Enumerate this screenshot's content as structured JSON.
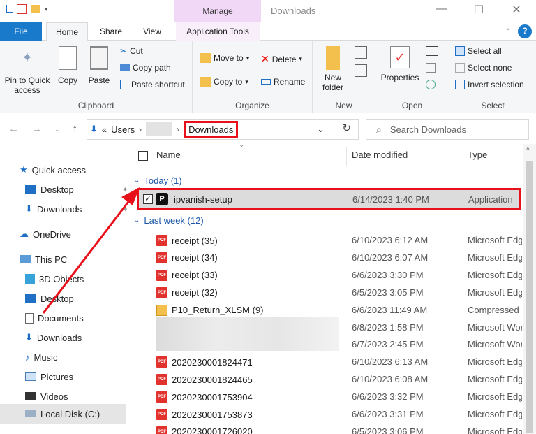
{
  "window": {
    "context_tab": "Manage",
    "title": "Downloads",
    "minimize_glyph": "—",
    "maximize_glyph": "☐",
    "close_glyph": "✕"
  },
  "tabs": {
    "file": "File",
    "home": "Home",
    "share": "Share",
    "view": "View",
    "app_tools": "Application Tools"
  },
  "ribbon": {
    "clipboard": {
      "label": "Clipboard",
      "pin": "Pin to Quick access",
      "copy": "Copy",
      "paste": "Paste",
      "cut": "Cut",
      "copy_path": "Copy path",
      "paste_shortcut": "Paste shortcut"
    },
    "organize": {
      "label": "Organize",
      "move_to": "Move to",
      "copy_to": "Copy to",
      "delete": "Delete",
      "rename": "Rename"
    },
    "new": {
      "label": "New",
      "new_folder": "New folder"
    },
    "open": {
      "label": "Open",
      "properties": "Properties"
    },
    "select": {
      "label": "Select",
      "select_all": "Select all",
      "select_none": "Select none",
      "invert": "Invert selection"
    }
  },
  "address": {
    "prefix": "«",
    "users": "Users",
    "downloads": "Downloads",
    "search_placeholder": "Search Downloads"
  },
  "nav": {
    "quick_access": "Quick access",
    "desktop": "Desktop",
    "downloads": "Downloads",
    "onedrive": "OneDrive",
    "this_pc": "This PC",
    "objects3d": "3D Objects",
    "desktop2": "Desktop",
    "documents": "Documents",
    "downloads2": "Downloads",
    "music": "Music",
    "pictures": "Pictures",
    "videos": "Videos",
    "local_disk": "Local Disk (C:)"
  },
  "columns": {
    "name": "Name",
    "date": "Date modified",
    "type": "Type"
  },
  "groups": {
    "today": "Today (1)",
    "last_week": "Last week (12)"
  },
  "selected_file": {
    "name": "ipvanish-setup",
    "date": "6/14/2023 1:40 PM",
    "type": "Application"
  },
  "files": [
    {
      "name": "receipt (35)",
      "date": "6/10/2023 6:12 AM",
      "type": "Microsoft Edge",
      "icon": "pdf"
    },
    {
      "name": "receipt (34)",
      "date": "6/10/2023 6:07 AM",
      "type": "Microsoft Edge",
      "icon": "pdf"
    },
    {
      "name": "receipt (33)",
      "date": "6/6/2023 3:30 PM",
      "type": "Microsoft Edge",
      "icon": "pdf"
    },
    {
      "name": "receipt (32)",
      "date": "6/5/2023 3:05 PM",
      "type": "Microsoft Edge",
      "icon": "pdf"
    },
    {
      "name": "P10_Return_XLSM (9)",
      "date": "6/6/2023 11:49 AM",
      "type": "Compressed",
      "icon": "zip"
    },
    {
      "name": "",
      "date": "6/8/2023 1:58 PM",
      "type": "Microsoft Word",
      "icon": "blur"
    },
    {
      "name": "",
      "date": "6/7/2023 2:45 PM",
      "type": "Microsoft Word",
      "icon": "blur"
    },
    {
      "name": "2020230001824471",
      "date": "6/10/2023 6:13 AM",
      "type": "Microsoft Edge",
      "icon": "pdf"
    },
    {
      "name": "2020230001824465",
      "date": "6/10/2023 6:08 AM",
      "type": "Microsoft Edge",
      "icon": "pdf"
    },
    {
      "name": "2020230001753904",
      "date": "6/6/2023 3:32 PM",
      "type": "Microsoft Edge",
      "icon": "pdf"
    },
    {
      "name": "2020230001753873",
      "date": "6/6/2023 3:31 PM",
      "type": "Microsoft Edge",
      "icon": "pdf"
    },
    {
      "name": "2020230001726020",
      "date": "6/5/2023 3:06 PM",
      "type": "Microsoft Edge",
      "icon": "pdf"
    }
  ],
  "icons": {
    "pdf_badge": "PDF",
    "app_badge": "P"
  },
  "colors": {
    "accent": "#1979ca",
    "highlight": "#e8101a",
    "manage_tab": "#f1d8f7"
  }
}
